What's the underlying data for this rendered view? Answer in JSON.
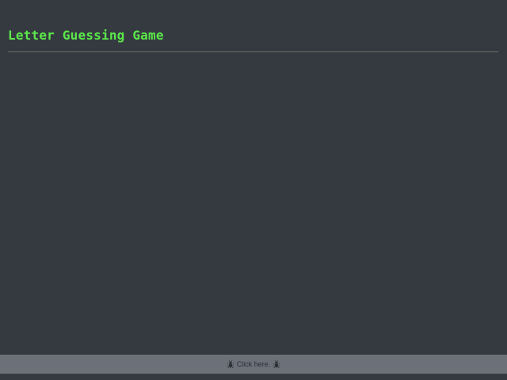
{
  "game": {
    "title": "Letter Guessing Game"
  },
  "footer": {
    "link_text": "Click here.",
    "left_icon": "bug-icon",
    "right_icon": "bug-icon"
  },
  "colors": {
    "background": "#353a40",
    "title": "#5be84a",
    "footer_bar": "#6b7079",
    "divider": "#6a6f6a"
  }
}
